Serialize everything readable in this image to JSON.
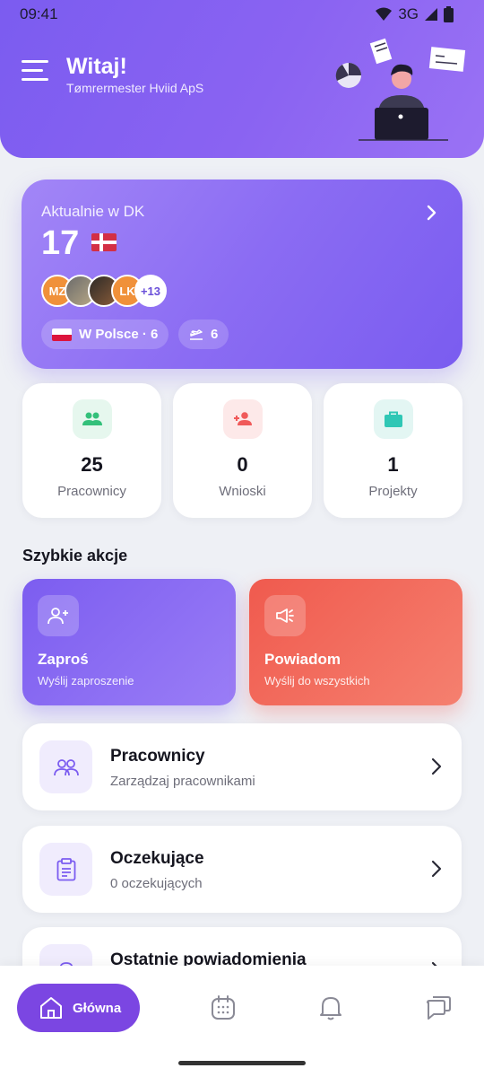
{
  "status_bar": {
    "time": "09:41",
    "network": "3G"
  },
  "header": {
    "greeting": "Witaj!",
    "company": "Tømrermester Hviid ApS"
  },
  "dk_card": {
    "label": "Aktualnie w DK",
    "count": "17",
    "avatars": [
      "MZ",
      "",
      "",
      "LK"
    ],
    "more_count": "+13",
    "in_poland": "W Polsce · 6",
    "traveling": "6"
  },
  "stats": [
    {
      "value": "25",
      "label": "Pracownicy",
      "icon": "users-icon",
      "color": "#33c07a"
    },
    {
      "value": "0",
      "label": "Wnioski",
      "icon": "user-add-icon",
      "color": "#f05a5a"
    },
    {
      "value": "1",
      "label": "Projekty",
      "icon": "briefcase-icon",
      "color": "#2fc7b5"
    }
  ],
  "quick_actions": {
    "title": "Szybkie akcje",
    "invite": {
      "title": "Zaproś",
      "subtitle": "Wyślij zaproszenie"
    },
    "notify": {
      "title": "Powiadom",
      "subtitle": "Wyślij do wszystkich"
    }
  },
  "list": [
    {
      "title": "Pracownicy",
      "subtitle": "Zarządzaj pracownikami",
      "icon": "users-icon"
    },
    {
      "title": "Oczekujące",
      "subtitle": "0 oczekujących",
      "icon": "clipboard-icon"
    },
    {
      "title": "Ostatnie powiadomienia",
      "subtitle": "",
      "icon": "bell-icon"
    }
  ],
  "bottom_nav": {
    "active_label": "Główna",
    "items": [
      "calendar-icon",
      "bell-icon",
      "chat-icon"
    ]
  },
  "colors": {
    "accent": "#7b5cf0",
    "danger": "#f05a4e",
    "nav_active": "#7b46e2"
  }
}
